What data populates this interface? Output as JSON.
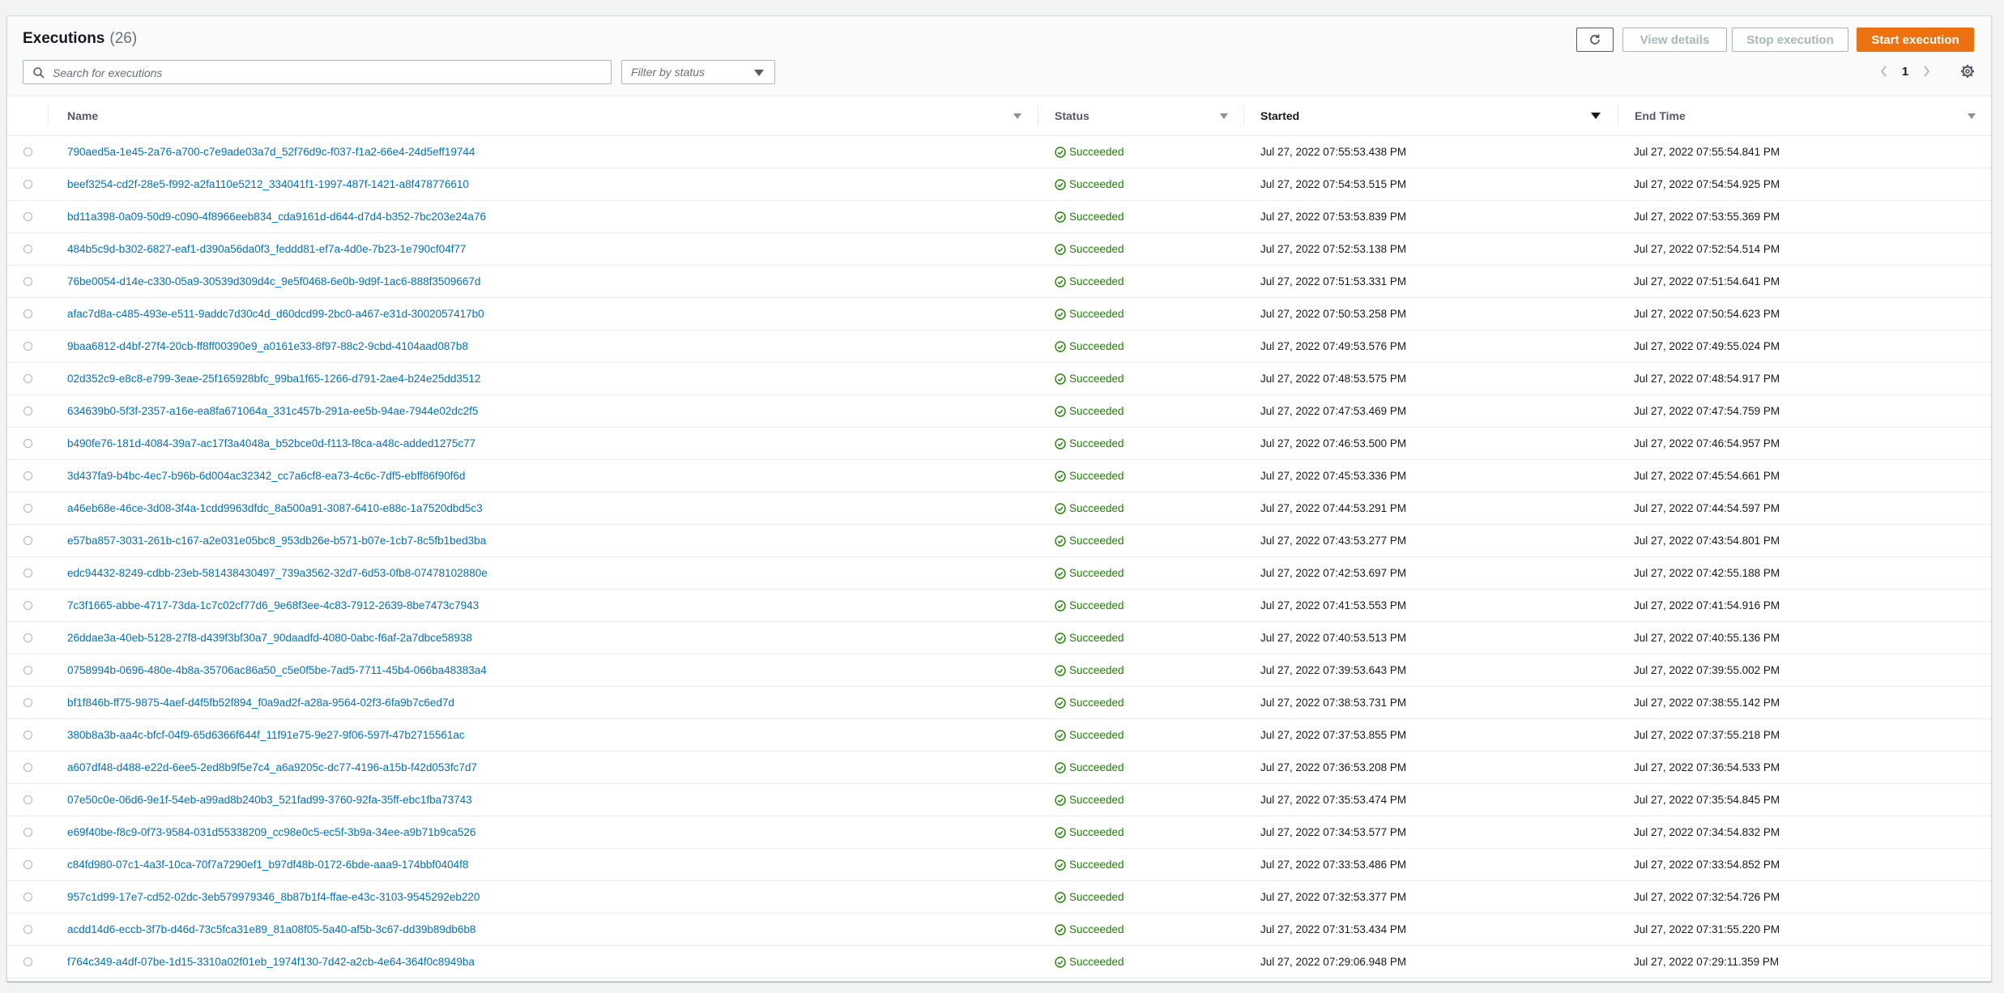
{
  "header": {
    "title": "Executions",
    "count": "(26)",
    "buttons": {
      "view_details": "View details",
      "stop_execution": "Stop execution",
      "start_execution": "Start execution"
    },
    "search_placeholder": "Search for executions",
    "filter_placeholder": "Filter by status",
    "page": "1"
  },
  "columns": {
    "name": "Name",
    "status": "Status",
    "started": "Started",
    "end_time": "End Time"
  },
  "colors": {
    "accent": "#ec7211",
    "link": "#0073bb",
    "success": "#1d8102"
  },
  "rows": [
    {
      "name": "790aed5a-1e45-2a76-a700-c7e9ade03a7d_52f76d9c-f037-f1a2-66e4-24d5eff19744",
      "status": "Succeeded",
      "started": "Jul 27, 2022 07:55:53.438 PM",
      "end": "Jul 27, 2022 07:55:54.841 PM"
    },
    {
      "name": "beef3254-cd2f-28e5-f992-a2fa110e5212_334041f1-1997-487f-1421-a8f478776610",
      "status": "Succeeded",
      "started": "Jul 27, 2022 07:54:53.515 PM",
      "end": "Jul 27, 2022 07:54:54.925 PM"
    },
    {
      "name": "bd11a398-0a09-50d9-c090-4f8966eeb834_cda9161d-d644-d7d4-b352-7bc203e24a76",
      "status": "Succeeded",
      "started": "Jul 27, 2022 07:53:53.839 PM",
      "end": "Jul 27, 2022 07:53:55.369 PM"
    },
    {
      "name": "484b5c9d-b302-6827-eaf1-d390a56da0f3_feddd81-ef7a-4d0e-7b23-1e790cf04f77",
      "status": "Succeeded",
      "started": "Jul 27, 2022 07:52:53.138 PM",
      "end": "Jul 27, 2022 07:52:54.514 PM"
    },
    {
      "name": "76be0054-d14e-c330-05a9-30539d309d4c_9e5f0468-6e0b-9d9f-1ac6-888f3509667d",
      "status": "Succeeded",
      "started": "Jul 27, 2022 07:51:53.331 PM",
      "end": "Jul 27, 2022 07:51:54.641 PM"
    },
    {
      "name": "afac7d8a-c485-493e-e511-9addc7d30c4d_d60dcd99-2bc0-a467-e31d-3002057417b0",
      "status": "Succeeded",
      "started": "Jul 27, 2022 07:50:53.258 PM",
      "end": "Jul 27, 2022 07:50:54.623 PM"
    },
    {
      "name": "9baa6812-d4bf-27f4-20cb-ff8ff00390e9_a0161e33-8f97-88c2-9cbd-4104aad087b8",
      "status": "Succeeded",
      "started": "Jul 27, 2022 07:49:53.576 PM",
      "end": "Jul 27, 2022 07:49:55.024 PM"
    },
    {
      "name": "02d352c9-e8c8-e799-3eae-25f165928bfc_99ba1f65-1266-d791-2ae4-b24e25dd3512",
      "status": "Succeeded",
      "started": "Jul 27, 2022 07:48:53.575 PM",
      "end": "Jul 27, 2022 07:48:54.917 PM"
    },
    {
      "name": "634639b0-5f3f-2357-a16e-ea8fa671064a_331c457b-291a-ee5b-94ae-7944e02dc2f5",
      "status": "Succeeded",
      "started": "Jul 27, 2022 07:47:53.469 PM",
      "end": "Jul 27, 2022 07:47:54.759 PM"
    },
    {
      "name": "b490fe76-181d-4084-39a7-ac17f3a4048a_b52bce0d-f113-f8ca-a48c-added1275c77",
      "status": "Succeeded",
      "started": "Jul 27, 2022 07:46:53.500 PM",
      "end": "Jul 27, 2022 07:46:54.957 PM"
    },
    {
      "name": "3d437fa9-b4bc-4ec7-b96b-6d004ac32342_cc7a6cf8-ea73-4c6c-7df5-ebff86f90f6d",
      "status": "Succeeded",
      "started": "Jul 27, 2022 07:45:53.336 PM",
      "end": "Jul 27, 2022 07:45:54.661 PM"
    },
    {
      "name": "a46eb68e-46ce-3d08-3f4a-1cdd9963dfdc_8a500a91-3087-6410-e88c-1a7520dbd5c3",
      "status": "Succeeded",
      "started": "Jul 27, 2022 07:44:53.291 PM",
      "end": "Jul 27, 2022 07:44:54.597 PM"
    },
    {
      "name": "e57ba857-3031-261b-c167-a2e031e05bc8_953db26e-b571-b07e-1cb7-8c5fb1bed3ba",
      "status": "Succeeded",
      "started": "Jul 27, 2022 07:43:53.277 PM",
      "end": "Jul 27, 2022 07:43:54.801 PM"
    },
    {
      "name": "edc94432-8249-cdbb-23eb-581438430497_739a3562-32d7-6d53-0fb8-07478102880e",
      "status": "Succeeded",
      "started": "Jul 27, 2022 07:42:53.697 PM",
      "end": "Jul 27, 2022 07:42:55.188 PM"
    },
    {
      "name": "7c3f1665-abbe-4717-73da-1c7c02cf77d6_9e68f3ee-4c83-7912-2639-8be7473c7943",
      "status": "Succeeded",
      "started": "Jul 27, 2022 07:41:53.553 PM",
      "end": "Jul 27, 2022 07:41:54.916 PM"
    },
    {
      "name": "26ddae3a-40eb-5128-27f8-d439f3bf30a7_90daadfd-4080-0abc-f6af-2a7dbce58938",
      "status": "Succeeded",
      "started": "Jul 27, 2022 07:40:53.513 PM",
      "end": "Jul 27, 2022 07:40:55.136 PM"
    },
    {
      "name": "0758994b-0696-480e-4b8a-35706ac86a50_c5e0f5be-7ad5-7711-45b4-066ba48383a4",
      "status": "Succeeded",
      "started": "Jul 27, 2022 07:39:53.643 PM",
      "end": "Jul 27, 2022 07:39:55.002 PM"
    },
    {
      "name": "bf1f846b-ff75-9875-4aef-d4f5fb52f894_f0a9ad2f-a28a-9564-02f3-6fa9b7c6ed7d",
      "status": "Succeeded",
      "started": "Jul 27, 2022 07:38:53.731 PM",
      "end": "Jul 27, 2022 07:38:55.142 PM"
    },
    {
      "name": "380b8a3b-aa4c-bfcf-04f9-65d6366f644f_11f91e75-9e27-9f06-597f-47b2715561ac",
      "status": "Succeeded",
      "started": "Jul 27, 2022 07:37:53.855 PM",
      "end": "Jul 27, 2022 07:37:55.218 PM"
    },
    {
      "name": "a607df48-d488-e22d-6ee5-2ed8b9f5e7c4_a6a9205c-dc77-4196-a15b-f42d053fc7d7",
      "status": "Succeeded",
      "started": "Jul 27, 2022 07:36:53.208 PM",
      "end": "Jul 27, 2022 07:36:54.533 PM"
    },
    {
      "name": "07e50c0e-06d6-9e1f-54eb-a99ad8b240b3_521fad99-3760-92fa-35ff-ebc1fba73743",
      "status": "Succeeded",
      "started": "Jul 27, 2022 07:35:53.474 PM",
      "end": "Jul 27, 2022 07:35:54.845 PM"
    },
    {
      "name": "e69f40be-f8c9-0f73-9584-031d55338209_cc98e0c5-ec5f-3b9a-34ee-a9b71b9ca526",
      "status": "Succeeded",
      "started": "Jul 27, 2022 07:34:53.577 PM",
      "end": "Jul 27, 2022 07:34:54.832 PM"
    },
    {
      "name": "c84fd980-07c1-4a3f-10ca-70f7a7290ef1_b97df48b-0172-6bde-aaa9-174bbf0404f8",
      "status": "Succeeded",
      "started": "Jul 27, 2022 07:33:53.486 PM",
      "end": "Jul 27, 2022 07:33:54.852 PM"
    },
    {
      "name": "957c1d99-17e7-cd52-02dc-3eb579979346_8b87b1f4-ffae-e43c-3103-9545292eb220",
      "status": "Succeeded",
      "started": "Jul 27, 2022 07:32:53.377 PM",
      "end": "Jul 27, 2022 07:32:54.726 PM"
    },
    {
      "name": "acdd14d6-eccb-3f7b-d46d-73c5fca31e89_81a08f05-5a40-af5b-3c67-dd39b89db6b8",
      "status": "Succeeded",
      "started": "Jul 27, 2022 07:31:53.434 PM",
      "end": "Jul 27, 2022 07:31:55.220 PM"
    },
    {
      "name": "f764c349-a4df-07be-1d15-3310a02f01eb_1974f130-7d42-a2cb-4e64-364f0c8949ba",
      "status": "Succeeded",
      "started": "Jul 27, 2022 07:29:06.948 PM",
      "end": "Jul 27, 2022 07:29:11.359 PM"
    }
  ]
}
